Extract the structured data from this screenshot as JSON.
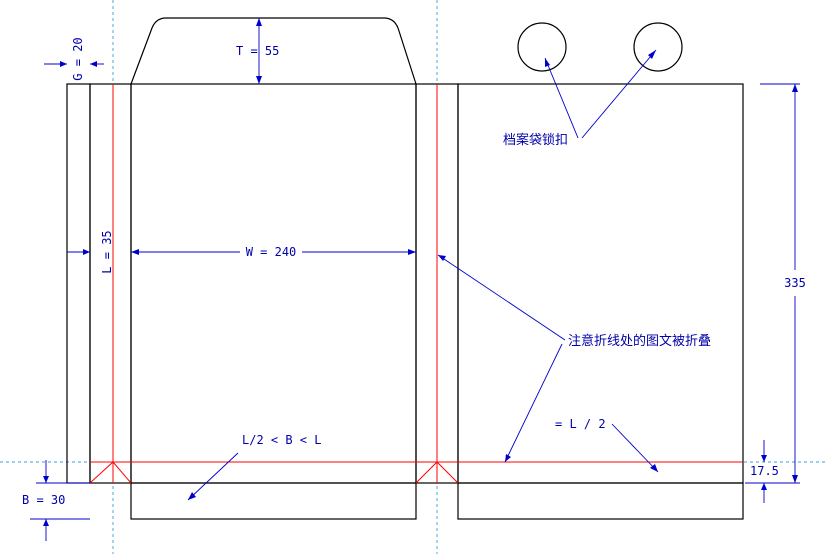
{
  "diagram": {
    "labels": {
      "gusset_top": "G = 20",
      "flap": "T = 55",
      "side": "L = 35",
      "width": "W = 240",
      "height": "335",
      "bottom": "B = 30",
      "bottom_fold": "17.5",
      "bottom_rule": "L/2 < B < L",
      "half_rule": "= L / 2"
    },
    "notes": {
      "lock": "档案袋锁扣",
      "fold_warning": "注意折线处的图文被折叠"
    },
    "colors": {
      "outline": "#000000",
      "fold_line": "#ff0000",
      "dimension": "#0000cc",
      "guide": "#3a9fd8"
    }
  }
}
